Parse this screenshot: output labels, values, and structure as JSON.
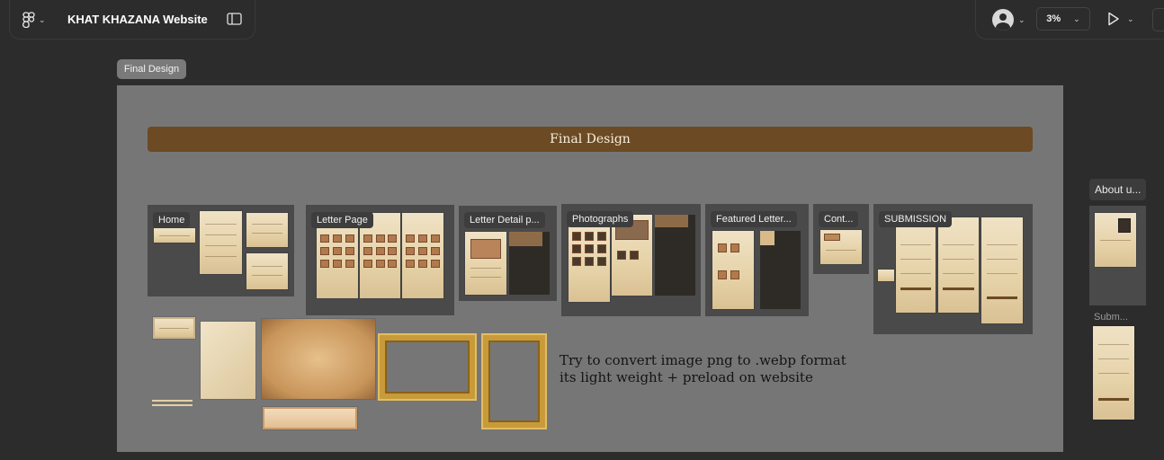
{
  "toolbar": {
    "file_title": "KHAT KHAZANA Website",
    "zoom": "3%"
  },
  "canvas": {
    "frame_tag": "Final Design",
    "banner_title": "Final Design",
    "sections": {
      "home": "Home",
      "letter_page": "Letter Page",
      "letter_detail": "Letter Detail p...",
      "photographs": "Photographs",
      "featured_letter": "Featured Letter...",
      "contact": "Cont...",
      "submission": "SUBMISSION"
    },
    "note_line1": "Try to convert image png to .webp format",
    "note_line2": "its light weight + preload on website",
    "right_frame_tag": "About u...",
    "right_frame_label": "Subm..."
  },
  "colors": {
    "canvas_bg": "#2c2c2c",
    "frame_bg": "#767676",
    "banner": "#6b4a24",
    "paper": "#e6d2a8",
    "gold": "#c89a3a"
  }
}
